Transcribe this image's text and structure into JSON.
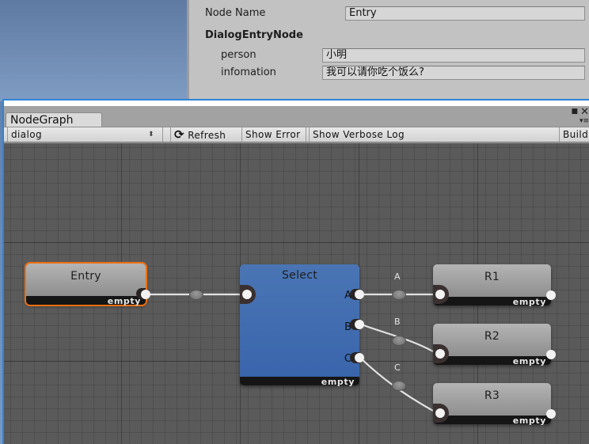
{
  "inspector": {
    "node_name_label": "Node Name",
    "node_name_value": "Entry",
    "section_title": "DialogEntryNode",
    "fields": [
      {
        "label": "person",
        "value": "小明"
      },
      {
        "label": "infomation",
        "value": "我可以请你吃个饭么?"
      }
    ]
  },
  "window": {
    "tab_label": "NodeGraph",
    "controls": {
      "maximize_icon": "maximize-icon",
      "close_icon": "close-icon",
      "menu_icon": "menu-icon"
    }
  },
  "toolbar": {
    "graph_select_value": "dialog",
    "refresh_label": "Refresh",
    "show_error_label": "Show Error",
    "show_verbose_log_label": "Show Verbose Log",
    "build_label": "Build"
  },
  "graph": {
    "nodes": [
      {
        "id": "entry",
        "title": "Entry",
        "footer": "empty",
        "selected": true,
        "color": "#9e9e9e"
      },
      {
        "id": "select",
        "title": "Select",
        "footer": "empty",
        "selected": false,
        "color": "#4470b2",
        "outputs": [
          "A",
          "B",
          "C"
        ]
      },
      {
        "id": "r1",
        "title": "R1",
        "footer": "empty",
        "selected": false,
        "color": "#9e9e9e"
      },
      {
        "id": "r2",
        "title": "R2",
        "footer": "empty",
        "selected": false,
        "color": "#9e9e9e"
      },
      {
        "id": "r3",
        "title": "R3",
        "footer": "empty",
        "selected": false,
        "color": "#9e9e9e"
      }
    ],
    "connections": [
      {
        "from": "entry",
        "to": "select",
        "label": ""
      },
      {
        "from": "select.A",
        "to": "r1",
        "label": "A"
      },
      {
        "from": "select.B",
        "to": "r2",
        "label": "B"
      },
      {
        "from": "select.C",
        "to": "r3",
        "label": "C"
      }
    ],
    "selection_color": "#f07010"
  }
}
